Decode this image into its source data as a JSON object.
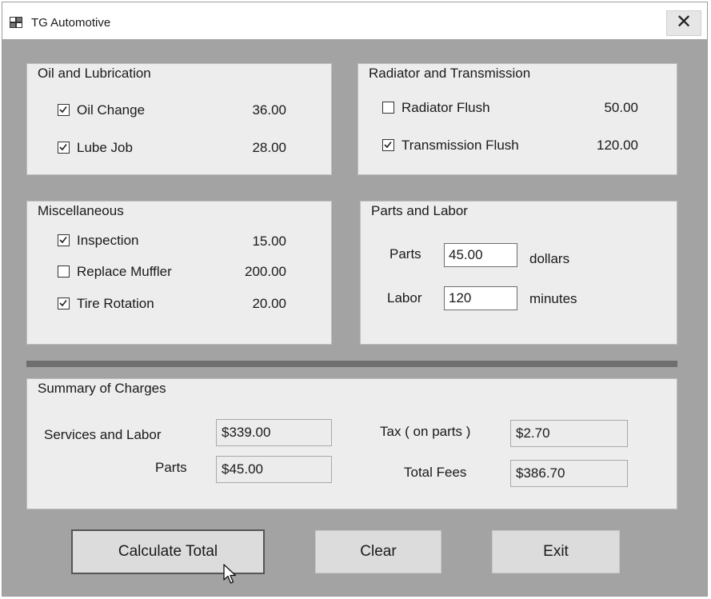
{
  "window": {
    "title": "TG Automotive",
    "close_glyph": "✕",
    "icon": "app-window-icon"
  },
  "oil_group": {
    "title": "Oil and Lubrication",
    "items": [
      {
        "label": "Oil Change",
        "price": "36.00",
        "checked": true
      },
      {
        "label": "Lube Job",
        "price": "28.00",
        "checked": true
      }
    ]
  },
  "radiator_group": {
    "title": "Radiator and Transmission",
    "items": [
      {
        "label": "Radiator Flush",
        "price": "50.00",
        "checked": false
      },
      {
        "label": "Transmission Flush",
        "price": "120.00",
        "checked": true
      }
    ]
  },
  "misc_group": {
    "title": "Miscellaneous",
    "items": [
      {
        "label": "Inspection",
        "price": "15.00",
        "checked": true
      },
      {
        "label": "Replace Muffler",
        "price": "200.00",
        "checked": false
      },
      {
        "label": "Tire Rotation",
        "price": "20.00",
        "checked": true
      }
    ]
  },
  "parts_labor": {
    "title": "Parts and Labor",
    "parts_label": "Parts",
    "parts_value": "45.00",
    "parts_unit": "dollars",
    "labor_label": "Labor",
    "labor_value": "120",
    "labor_unit": "minutes"
  },
  "summary": {
    "title": "Summary of Charges",
    "services_label": "Services and Labor",
    "services_value": "$339.00",
    "parts_label": "Parts",
    "parts_value": "$45.00",
    "tax_label": "Tax ( on parts )",
    "tax_value": "$2.70",
    "total_label": "Total Fees",
    "total_value": "$386.70"
  },
  "buttons": {
    "calculate": "Calculate Total",
    "clear": "Clear",
    "exit": "Exit"
  }
}
